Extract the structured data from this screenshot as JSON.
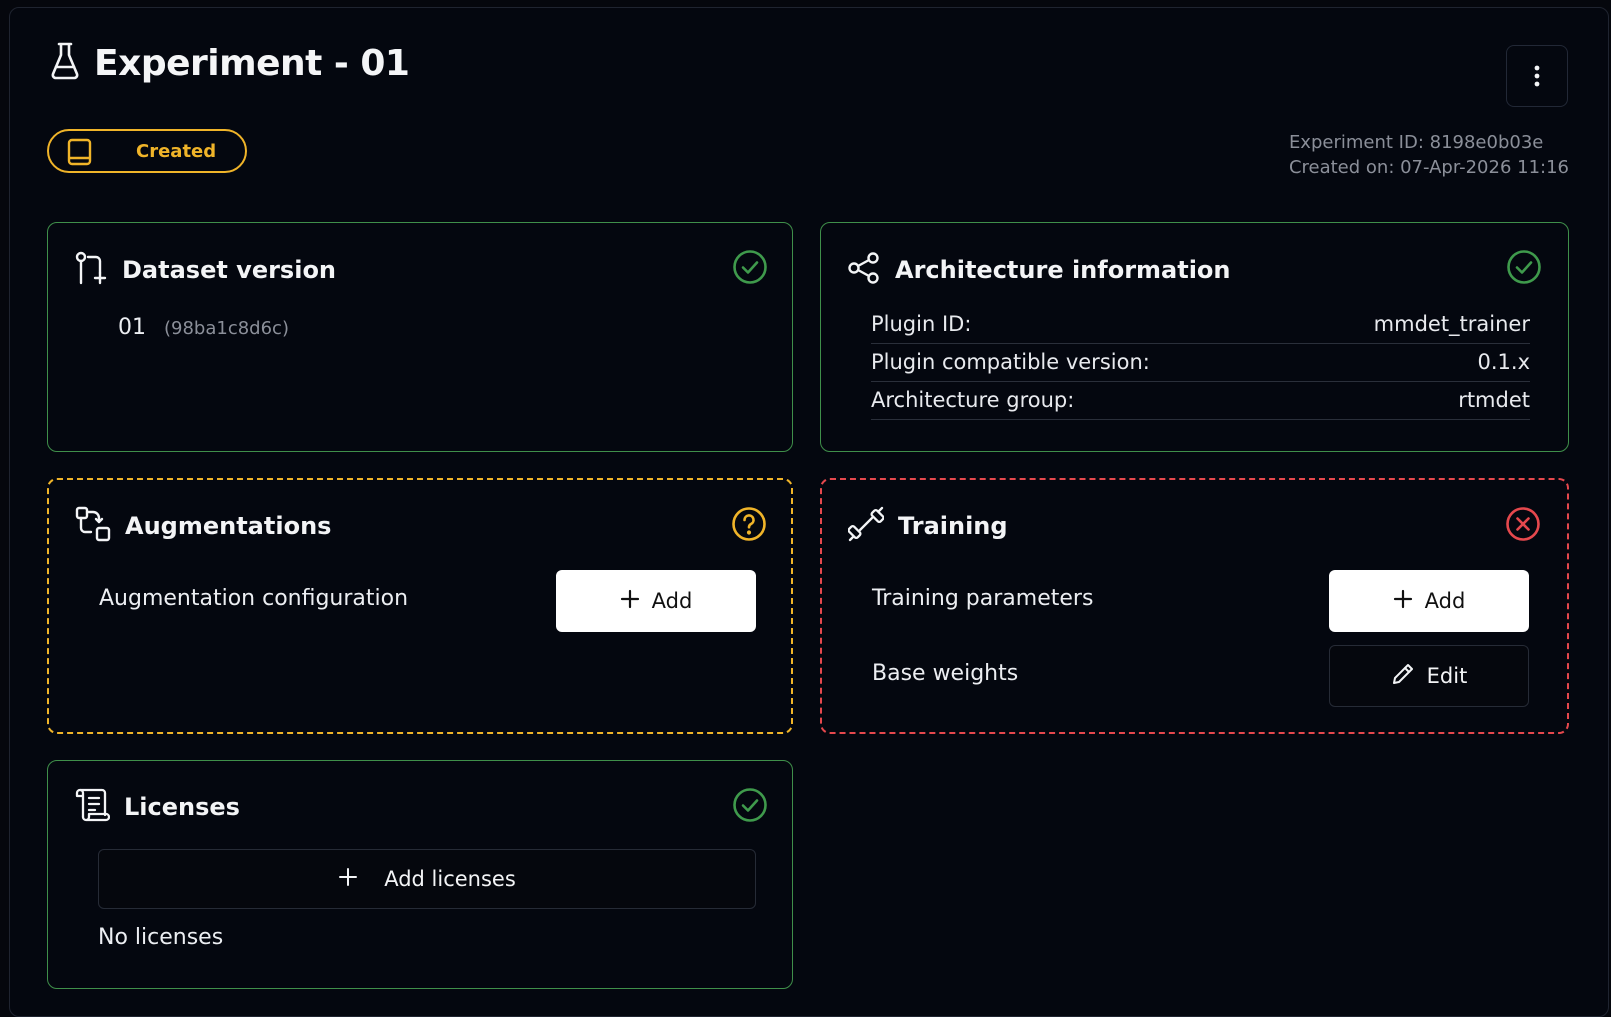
{
  "header": {
    "title": "Experiment - 01",
    "status": "Created",
    "experiment_id": "Experiment ID: 8198e0b03e",
    "created_on": "Created on: 07-Apr-2026 11:16"
  },
  "dataset": {
    "title": "Dataset version",
    "version": "01",
    "hash": "(98ba1c8d6c)",
    "state": "complete"
  },
  "architecture": {
    "title": "Architecture information",
    "state": "complete",
    "rows": [
      {
        "label": "Plugin ID:",
        "value": "mmdet_trainer"
      },
      {
        "label": "Plugin compatible version:",
        "value": "0.1.x"
      },
      {
        "label": "Architecture group:",
        "value": "rtmdet"
      }
    ]
  },
  "augmentations": {
    "title": "Augmentations",
    "state": "unknown",
    "row_label": "Augmentation configuration",
    "add_label": "Add"
  },
  "training": {
    "title": "Training",
    "state": "error",
    "params_label": "Training parameters",
    "params_button": "Add",
    "weights_label": "Base weights",
    "weights_button": "Edit"
  },
  "licenses": {
    "title": "Licenses",
    "state": "complete",
    "add_label": "Add licenses",
    "empty_text": "No licenses"
  },
  "colors": {
    "ok": "#3f8f4a",
    "warn": "#f0b429",
    "error": "#e5484d",
    "background": "#05070d"
  }
}
